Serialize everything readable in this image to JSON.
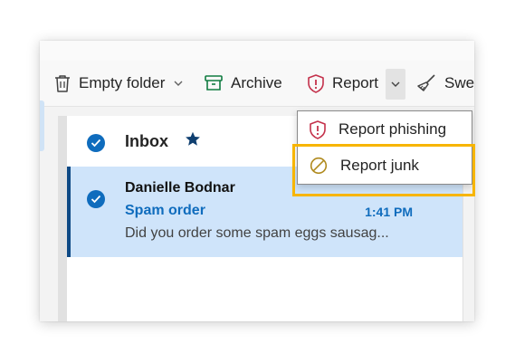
{
  "toolbar": {
    "empty_folder_label": "Empty folder",
    "archive_label": "Archive",
    "report_label": "Report",
    "sweep_label": "Swee"
  },
  "inbox": {
    "title": "Inbox"
  },
  "email": {
    "sender": "Danielle Bodnar",
    "subject": "Spam order",
    "time": "1:41 PM",
    "preview": "Did you order some spam eggs sausag..."
  },
  "report_menu": {
    "items": [
      {
        "label": "Report phishing",
        "icon": "shield-alert-icon"
      },
      {
        "label": "Report junk",
        "icon": "block-icon"
      }
    ]
  },
  "colors": {
    "accent": "#0f6cbd",
    "selected_row": "#cfe4fa",
    "selected_bar": "#0f4a85",
    "report_red": "#c4314b",
    "archive_green": "#107c41",
    "highlight": "#f7b500"
  }
}
